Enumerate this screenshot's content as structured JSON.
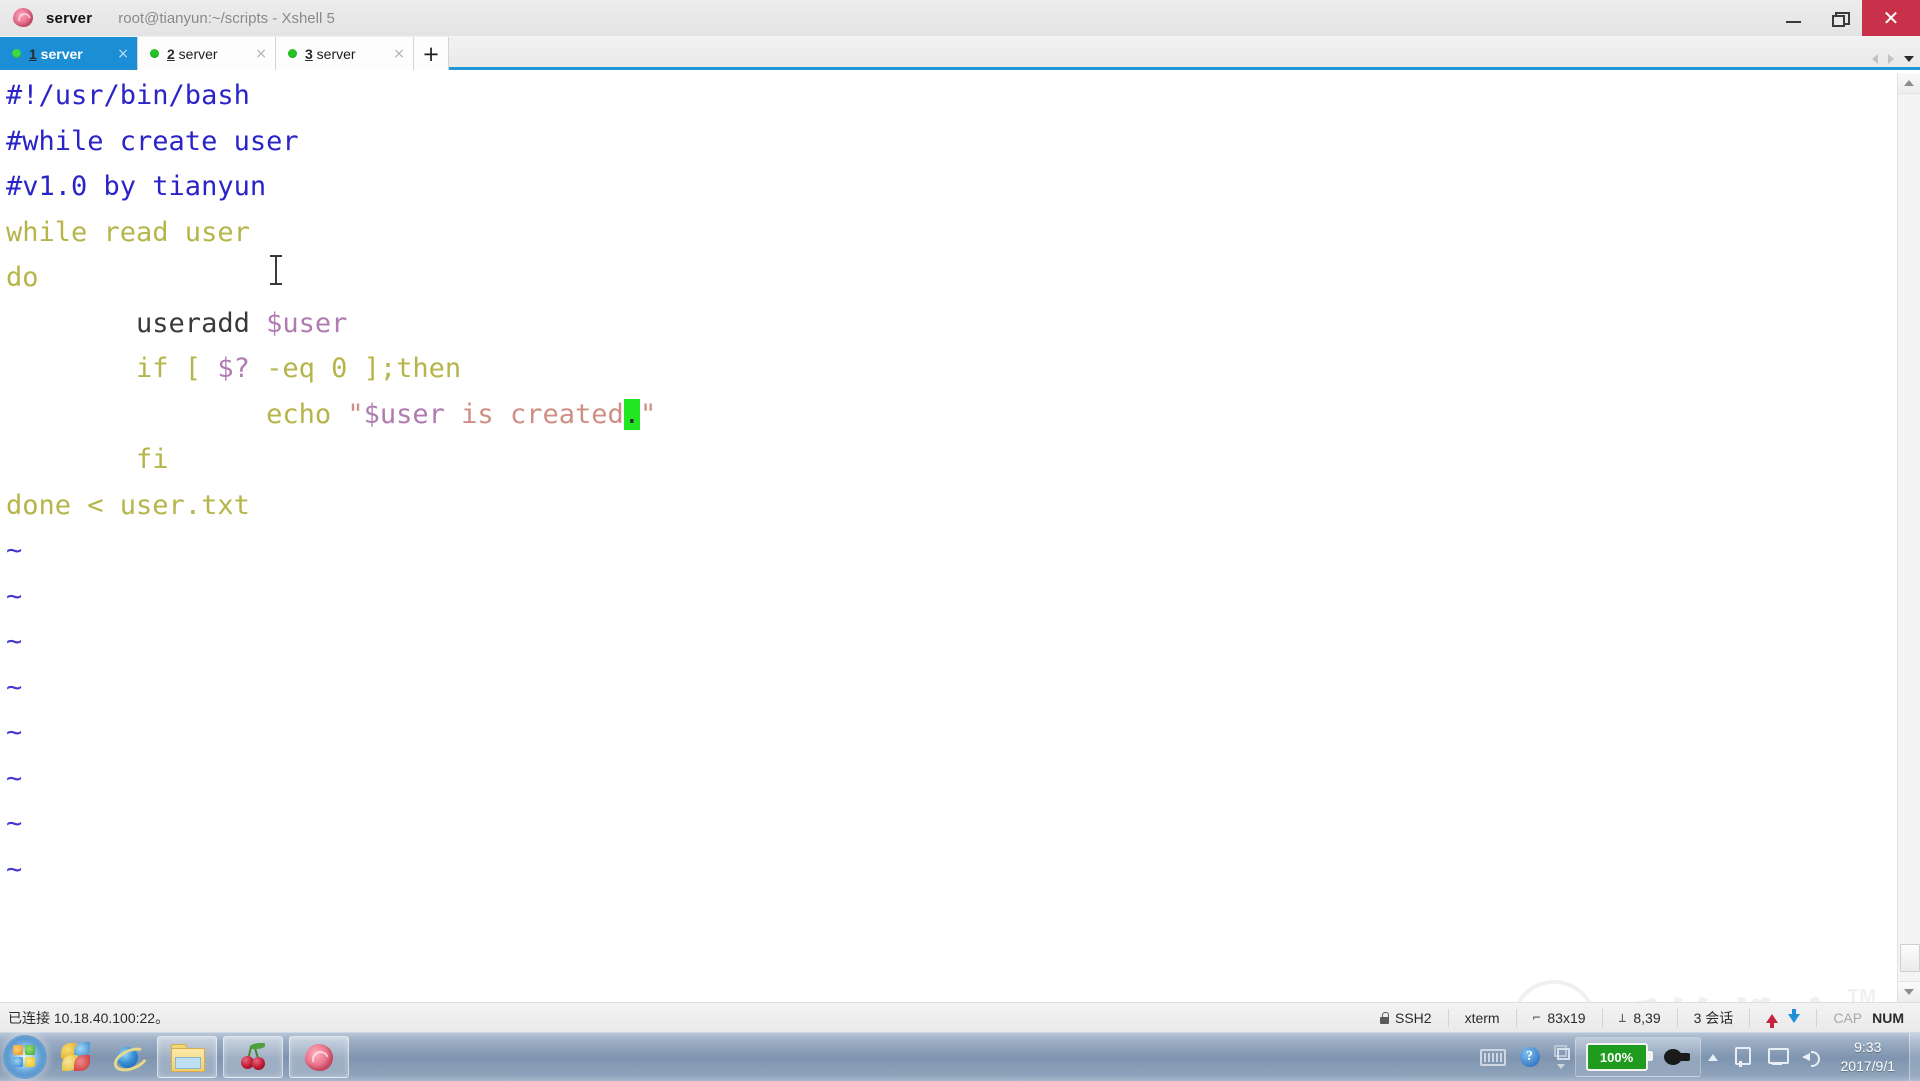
{
  "window": {
    "app_icon": "rose-icon",
    "app_name": "server",
    "title": "root@tianyun:~/scripts - Xshell 5",
    "minimize_label": "Minimize",
    "restore_label": "Restore",
    "close_label": "Close"
  },
  "tabs": {
    "items": [
      {
        "num": "1",
        "name": " server",
        "status": "connected",
        "active": true,
        "close": "×"
      },
      {
        "num": "2",
        "name": " server",
        "status": "connected",
        "active": false,
        "close": "×"
      },
      {
        "num": "3",
        "name": " server",
        "status": "connected",
        "active": false,
        "close": "×"
      }
    ],
    "add_label": "+",
    "nav_prev": "prev-tab",
    "nav_next": "next-tab",
    "nav_list": "tab-list"
  },
  "terminal": {
    "lines": [
      [
        {
          "t": "#!/usr/bin/bash",
          "c": "comment"
        }
      ],
      [
        {
          "t": "#while create user",
          "c": "comment"
        }
      ],
      [
        {
          "t": "#v1.0 by tianyun",
          "c": "comment"
        }
      ],
      [
        {
          "t": "while read user",
          "c": "stmt"
        }
      ],
      [
        {
          "t": "do",
          "c": "stmt"
        }
      ],
      [
        {
          "t": "        useradd ",
          "c": "cmd"
        },
        {
          "t": "$user",
          "c": "var"
        }
      ],
      [
        {
          "t": "        if [ ",
          "c": "stmt"
        },
        {
          "t": "$?",
          "c": "var"
        },
        {
          "t": " -eq 0 ];then",
          "c": "stmt"
        }
      ],
      [
        {
          "t": "                echo ",
          "c": "stmt"
        },
        {
          "t": "\"",
          "c": "str"
        },
        {
          "t": "$user",
          "c": "var"
        },
        {
          "t": " is created",
          "c": "str"
        },
        {
          "t": ".",
          "c": "cursor"
        },
        {
          "t": "\"",
          "c": "str"
        }
      ],
      [
        {
          "t": "        fi",
          "c": "stmt"
        }
      ],
      [
        {
          "t": "done < user.txt",
          "c": "stmt"
        }
      ],
      [
        {
          "t": "~",
          "c": "tilde"
        }
      ],
      [
        {
          "t": "~",
          "c": "tilde"
        }
      ],
      [
        {
          "t": "~",
          "c": "tilde"
        }
      ],
      [
        {
          "t": "~",
          "c": "tilde"
        }
      ],
      [
        {
          "t": "~",
          "c": "tilde"
        }
      ],
      [
        {
          "t": "~",
          "c": "tilde"
        }
      ],
      [
        {
          "t": "~",
          "c": "tilde"
        }
      ],
      [
        {
          "t": "~",
          "c": "tilde"
        }
      ]
    ],
    "colors": {
      "background": "#ffffff",
      "comment": "#2a24c8",
      "statement": "#b5b54a",
      "command": "#3a3a3a",
      "variable": "#b07bb0",
      "string": "#cf8f84",
      "tilde": "#4438d0",
      "cursor_bg": "#21e621"
    }
  },
  "watermark": {
    "text": "千锋教育",
    "tm": "TM",
    "logo": "q-logo-icon"
  },
  "statusbar": {
    "connection": "已连接 10.18.40.100:22。",
    "protocol": "SSH2",
    "terminal_type": "xterm",
    "size": "83x19",
    "position": "8,39",
    "sessions": "3 会话",
    "upload_icon": "upload-arrow-icon",
    "download_icon": "download-arrow-icon",
    "cap": "CAP",
    "num": "NUM"
  },
  "taskbar": {
    "start": "start-orb",
    "pinned": [
      {
        "name": "firefox-like-icon",
        "kind": "plain"
      },
      {
        "name": "internet-explorer-icon",
        "kind": "plain"
      }
    ],
    "windows": [
      {
        "name": "file-explorer-icon"
      },
      {
        "name": "cherrytree-icon"
      },
      {
        "name": "xshell-icon"
      }
    ],
    "tray": {
      "keyboard_icon": "keyboard-icon",
      "help_icon": "help-icon",
      "help_glyph": "?",
      "stack_icon": "window-stack-icon",
      "battery_percent": "100%",
      "plug_icon": "power-plug-icon",
      "expand_icon": "show-hidden-icons-icon",
      "network_icon": "network-icon",
      "monitor_icon": "display-icon",
      "volume_icon": "volume-icon",
      "time": "9:33",
      "date": "2017/9/1",
      "show_desktop": "show-desktop-button"
    }
  }
}
